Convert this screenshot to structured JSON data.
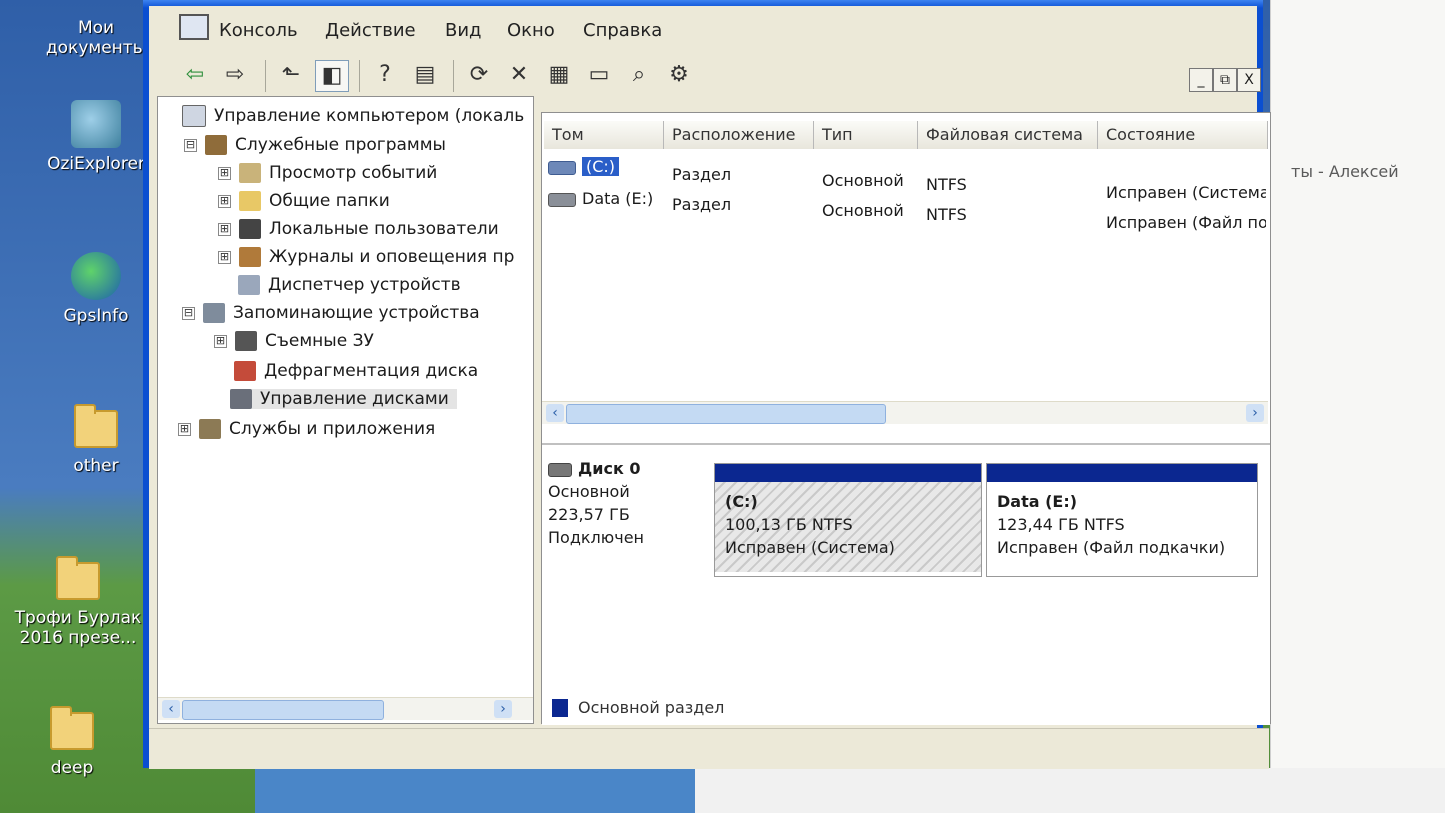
{
  "desktop": {
    "icons": [
      {
        "label": "Мои документы"
      },
      {
        "label": "OziExplorer"
      },
      {
        "label": "GpsInfo"
      },
      {
        "label": "other"
      },
      {
        "label": "Трофи Бурлак 2016 презе..."
      },
      {
        "label": "deep"
      }
    ],
    "background_window_text": "ты - Алексей"
  },
  "window": {
    "menu": [
      "Консоль",
      "Действие",
      "Вид",
      "Окно",
      "Справка"
    ],
    "caption_buttons": {
      "minimize": "_",
      "maximize": "□",
      "close": "X"
    },
    "mdi_buttons": {
      "minimize": "_",
      "restore": "⧉",
      "close": "X"
    }
  },
  "toolbar": {
    "icons": [
      "back-icon",
      "forward-icon",
      "up-folder-icon",
      "show-hide-tree-icon",
      "help-icon",
      "properties-pane-icon",
      "refresh-icon",
      "delete-icon",
      "properties-icon",
      "open-icon",
      "search-icon",
      "settings-icon"
    ]
  },
  "tree": {
    "root": "Управление компьютером (локаль",
    "items": [
      {
        "label": "Служебные программы",
        "expander": "⊟"
      },
      {
        "label": "Просмотр событий",
        "expander": "⊞"
      },
      {
        "label": "Общие папки",
        "expander": "⊞"
      },
      {
        "label": "Локальные пользователи",
        "expander": "⊞"
      },
      {
        "label": "Журналы и оповещения пр",
        "expander": "⊞"
      },
      {
        "label": "Диспетчер устройств",
        "expander": ""
      },
      {
        "label": "Запоминающие устройства",
        "expander": "⊟"
      },
      {
        "label": "Съемные ЗУ",
        "expander": "⊞"
      },
      {
        "label": "Дефрагментация диска",
        "expander": ""
      },
      {
        "label": "Управление дисками",
        "expander": ""
      },
      {
        "label": "Службы и приложения",
        "expander": "⊞"
      }
    ]
  },
  "volume_list": {
    "columns": [
      "Том",
      "Расположение",
      "Тип",
      "Файловая система",
      "Состояние"
    ],
    "rows": [
      {
        "volume": "(C:)",
        "layout": "Раздел",
        "type": "Основной",
        "fs": "NTFS",
        "status": "Исправен (Система"
      },
      {
        "volume": "Data (E:)",
        "layout": "Раздел",
        "type": "Основной",
        "fs": "NTFS",
        "status": "Исправен (Файл по"
      }
    ]
  },
  "disk_map": {
    "disk": {
      "name": "Диск 0",
      "type": "Основной",
      "size": "223,57 ГБ",
      "state": "Подключен"
    },
    "partitions": [
      {
        "name": "(C:)",
        "size": "100,13 ГБ NTFS",
        "status": "Исправен (Система)"
      },
      {
        "name": "Data  (E:)",
        "size": "123,44 ГБ NTFS",
        "status": "Исправен (Файл подкачки)"
      }
    ],
    "legend": "Основной раздел",
    "primary_color": "#0b2790"
  }
}
